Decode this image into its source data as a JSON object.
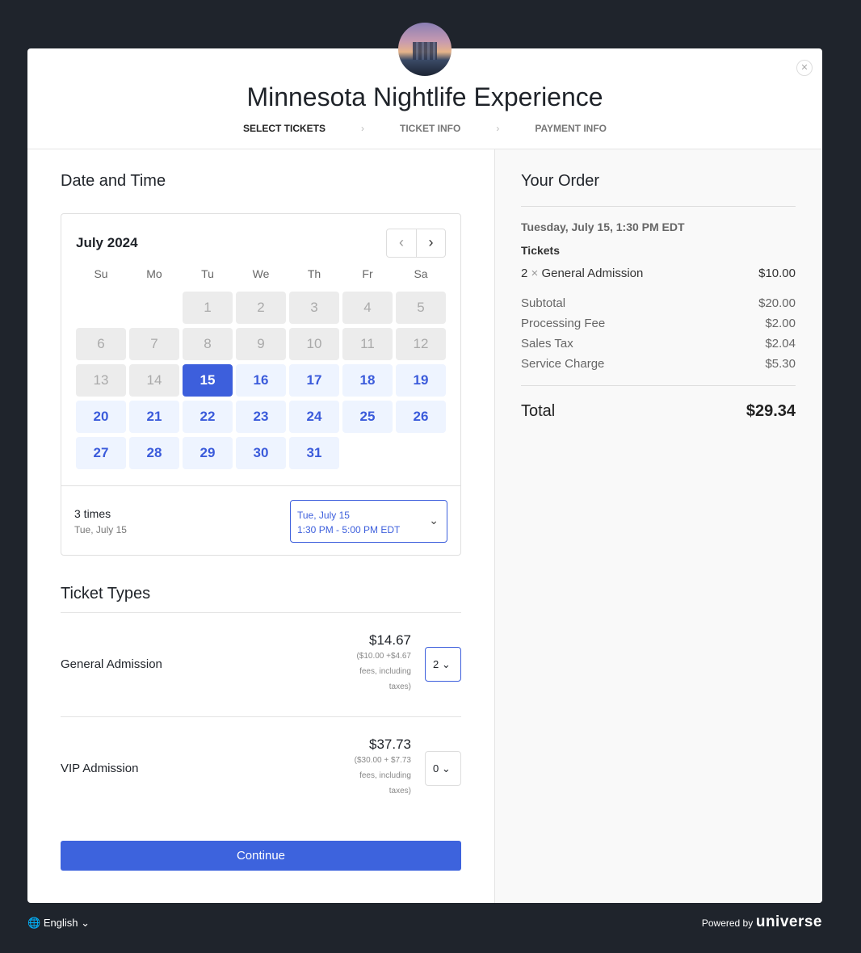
{
  "event": {
    "title": "Minnesota Nightlife Experience"
  },
  "steps": [
    "SELECT TICKETS",
    "TICKET INFO",
    "PAYMENT INFO"
  ],
  "date_time": {
    "heading": "Date and Time",
    "month": "July 2024",
    "weekdays": [
      "Su",
      "Mo",
      "Tu",
      "We",
      "Th",
      "Fr",
      "Sa"
    ],
    "leading_blanks": 2,
    "days_in_month": 31,
    "first_available": 15,
    "selected_day": 15,
    "times_count": "3 times",
    "times_date": "Tue, July 15",
    "selected_time": {
      "date": "Tue, July 15",
      "range": "1:30 PM - 5:00 PM EDT"
    }
  },
  "ticket_types": {
    "heading": "Ticket Types",
    "items": [
      {
        "name": "General Admission",
        "price": "$14.67",
        "fee": "($10.00 +$4.67 fees, including taxes)",
        "qty": "2"
      },
      {
        "name": "VIP Admission",
        "price": "$37.73",
        "fee": "($30.00 + $7.73 fees, including taxes)",
        "qty": "0"
      }
    ]
  },
  "continue_label": "Continue",
  "order": {
    "heading": "Your Order",
    "datetime": "Tuesday, July 15, 1:30 PM EDT",
    "tickets_label": "Tickets",
    "line": {
      "qty": "2",
      "x": "×",
      "name": "General Admission",
      "price": "$10.00"
    },
    "fees": [
      {
        "label": "Subtotal",
        "value": "$20.00"
      },
      {
        "label": "Processing Fee",
        "value": "$2.00"
      },
      {
        "label": "Sales Tax",
        "value": "$2.04"
      },
      {
        "label": "Service Charge",
        "value": "$5.30"
      }
    ],
    "total_label": "Total",
    "total": "$29.34"
  },
  "footer": {
    "language": "English",
    "powered": "Powered by",
    "brand": "universe"
  },
  "colors": {
    "accent": "#3d5fdc",
    "background": "#1f242c"
  }
}
